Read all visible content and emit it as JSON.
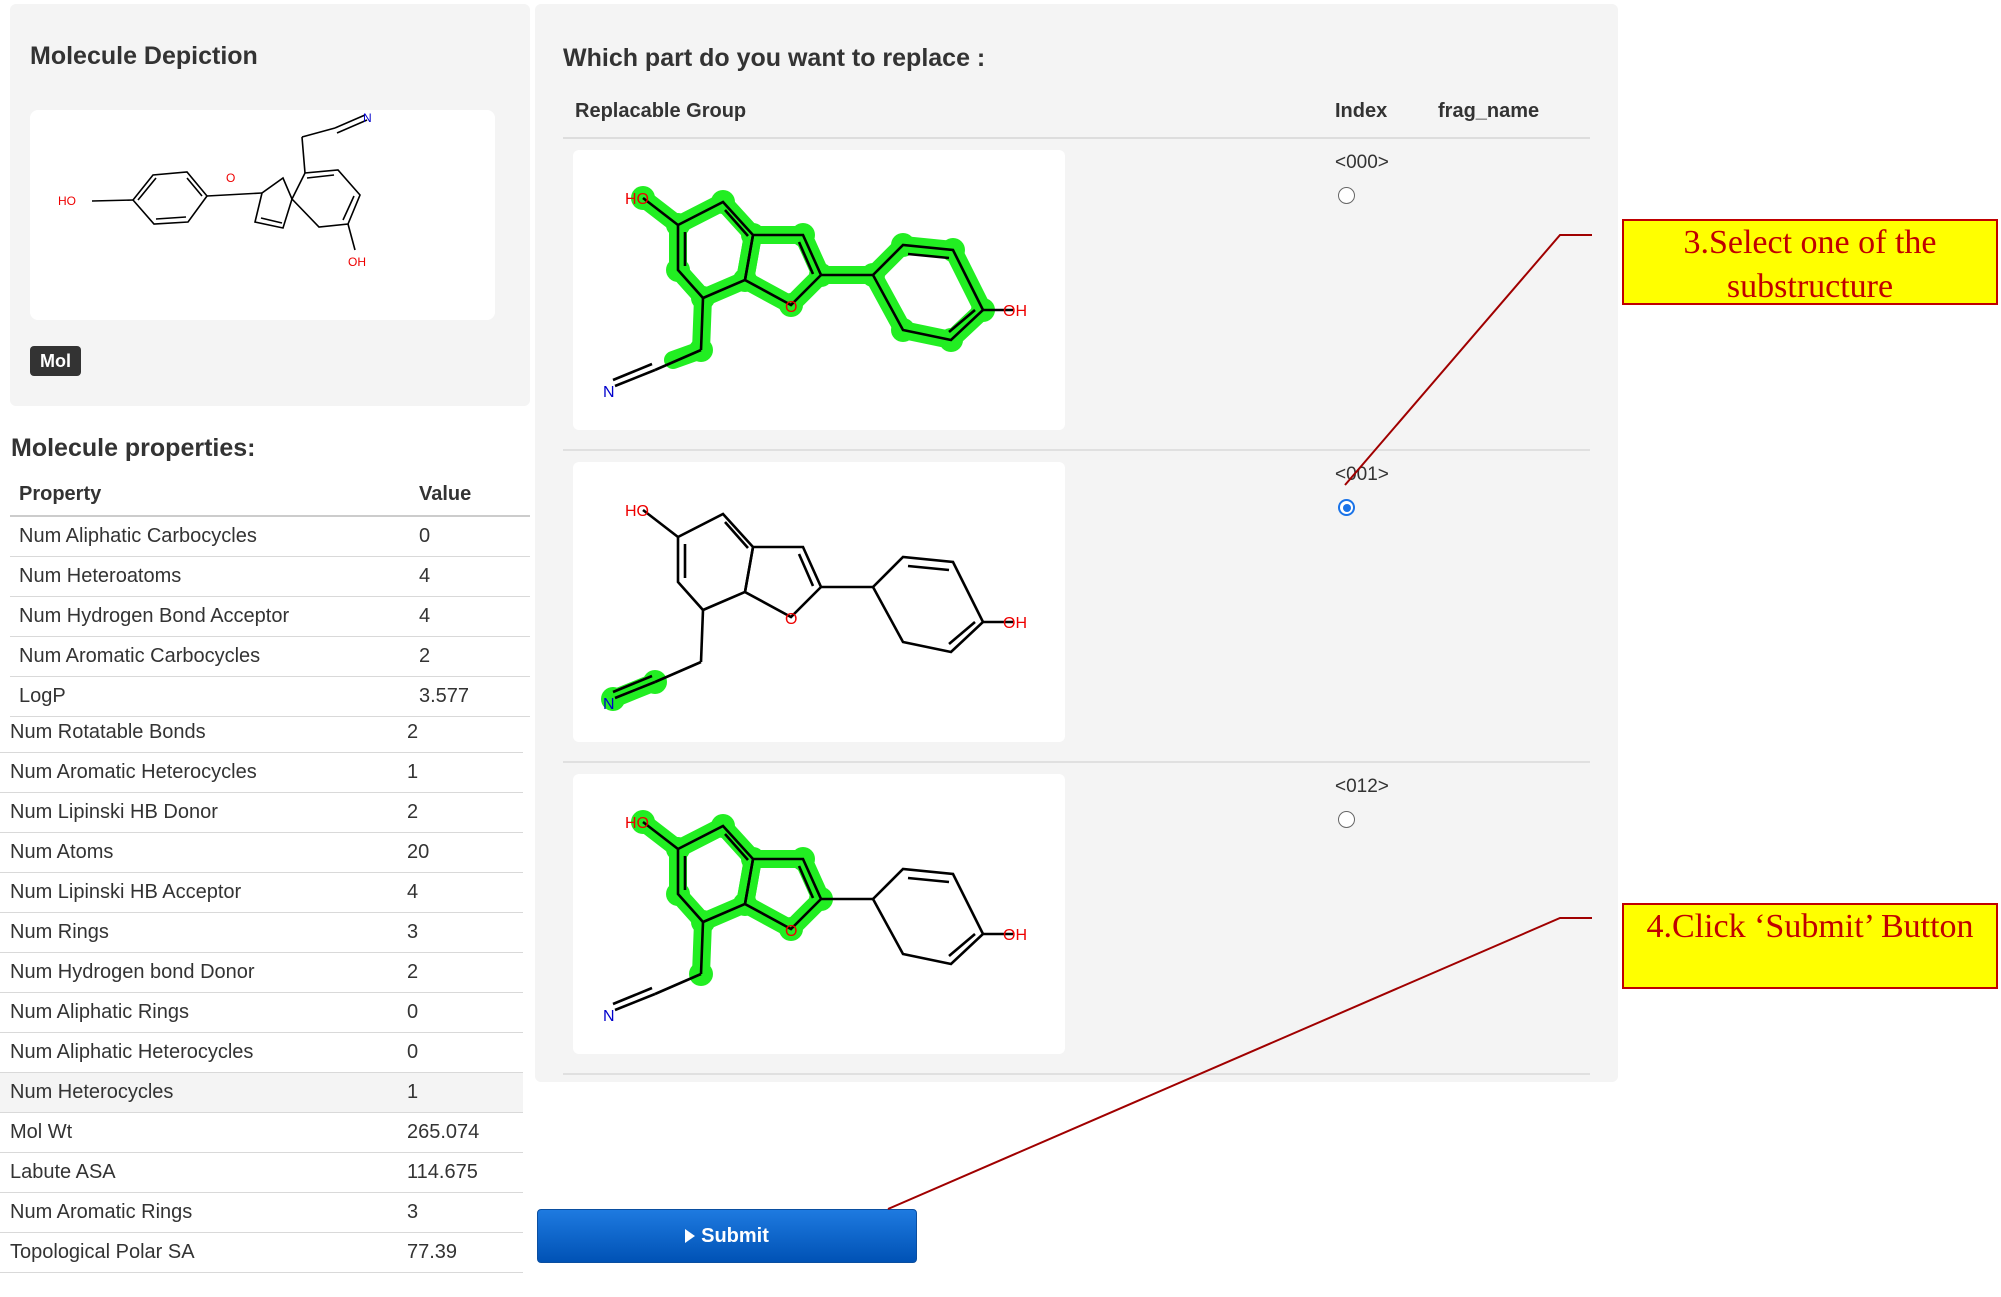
{
  "depiction": {
    "title": "Molecule Depiction",
    "badge": "Mol",
    "atom_labels": {
      "ho": "HO",
      "oh": "OH",
      "o": "O",
      "n": "N"
    }
  },
  "properties": {
    "title": "Molecule properties:",
    "header": {
      "property": "Property",
      "value": "Value"
    },
    "rows_a": [
      {
        "name": "Num Aliphatic Carbocycles",
        "value": "0"
      },
      {
        "name": "Num Heteroatoms",
        "value": "4"
      },
      {
        "name": "Num Hydrogen Bond Acceptor",
        "value": "4"
      },
      {
        "name": "Num Aromatic Carbocycles",
        "value": "2"
      },
      {
        "name": "LogP",
        "value": "3.577"
      }
    ],
    "rows_b": [
      {
        "name": "Num Rotatable Bonds",
        "value": "2"
      },
      {
        "name": "Num Aromatic Heterocycles",
        "value": "1"
      },
      {
        "name": "Num Lipinski HB Donor",
        "value": "2"
      },
      {
        "name": "Num Atoms",
        "value": "20"
      },
      {
        "name": "Num Lipinski HB Acceptor",
        "value": "4"
      },
      {
        "name": "Num Rings",
        "value": "3"
      },
      {
        "name": "Num Hydrogen bond Donor",
        "value": "2"
      },
      {
        "name": "Num Aliphatic Rings",
        "value": "0"
      },
      {
        "name": "Num Aliphatic Heterocycles",
        "value": "0"
      },
      {
        "name": "Num Heterocycles",
        "value": "1"
      },
      {
        "name": "Mol Wt",
        "value": "265.074"
      },
      {
        "name": "Labute ASA",
        "value": "114.675"
      },
      {
        "name": "Num Aromatic Rings",
        "value": "3"
      },
      {
        "name": "Topological Polar SA",
        "value": "77.39"
      }
    ]
  },
  "replace": {
    "title": "Which part do you want to replace :",
    "headers": {
      "group": "Replacable Group",
      "index": "Index",
      "frag": "frag_name"
    },
    "fragments": [
      {
        "index": "<000>",
        "selected": false,
        "highlight": "core"
      },
      {
        "index": "<001>",
        "selected": true,
        "highlight": "nitrile"
      },
      {
        "index": "<012>",
        "selected": false,
        "highlight": "benzofuran"
      }
    ],
    "highlight_color": "#22ee22"
  },
  "submit": {
    "label": "Submit"
  },
  "annotations": {
    "step3": "3.Select one of the substructure",
    "step4": "4.Click ‘Submit’ Button"
  }
}
